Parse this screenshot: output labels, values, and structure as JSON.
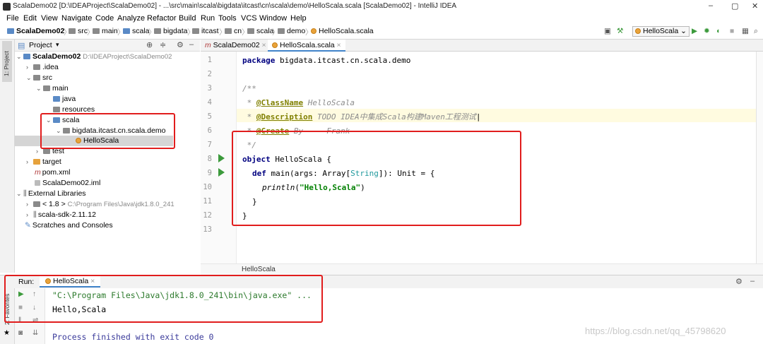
{
  "window": {
    "title": "ScalaDemo02 [D:\\IDEAProject\\ScalaDemo02] - ...\\src\\main\\scala\\bigdata\\itcast\\cn\\scala\\demo\\HelloScala.scala [ScalaDemo02] - IntelliJ IDEA",
    "minimize": "–",
    "restore": "▢",
    "close": "✕"
  },
  "menu": [
    "File",
    "Edit",
    "View",
    "Navigate",
    "Code",
    "Analyze",
    "Refactor",
    "Build",
    "Run",
    "Tools",
    "VCS",
    "Window",
    "Help"
  ],
  "breadcrumbs": [
    "ScalaDemo02",
    "src",
    "main",
    "scala",
    "bigdata",
    "itcast",
    "cn",
    "scala",
    "demo",
    "HelloScala.scala"
  ],
  "toolbar": {
    "run_config": "HelloScala"
  },
  "project": {
    "panel_title": "Project",
    "side_tab": "1: Project",
    "favorites_tab": "2: Favorites",
    "tree": {
      "root": "ScalaDemo02",
      "root_path": "D:\\IDEAProject\\ScalaDemo02",
      "idea": ".idea",
      "src": "src",
      "main": "main",
      "java": "java",
      "resources": "resources",
      "scala": "scala",
      "package": "bigdata.itcast.cn.scala.demo",
      "class": "HelloScala",
      "test": "test",
      "target": "target",
      "pom": "pom.xml",
      "iml": "ScalaDemo02.iml",
      "ext_libs": "External Libraries",
      "jdk": "< 1.8 >",
      "jdk_path": "C:\\Program Files\\Java\\jdk1.8.0_241",
      "scala_sdk": "scala-sdk-2.11.12",
      "scratches": "Scratches and Consoles"
    }
  },
  "editor": {
    "tabs": [
      "ScalaDemo02",
      "HelloScala.scala"
    ],
    "line_numbers": [
      "1",
      "2",
      "3",
      "4",
      "5",
      "6",
      "7",
      "8",
      "9",
      "10",
      "11",
      "12",
      "13"
    ],
    "code": {
      "l1_kw": "package",
      "l1_rest": " bigdata.itcast.cn.scala.demo",
      "l3": "/**",
      "l4_star": " * ",
      "l4_tag": "@ClassName",
      "l4_rest": " HelloScala",
      "l5_star": " * ",
      "l5_tag": "@Description",
      "l5_rest": " TODO IDEA中集成Scala构建Maven工程测试",
      "l6_star": " * ",
      "l6_tag": "@Create",
      "l6_rest": " By     Frank",
      "l7": " */",
      "l8_kw": "object",
      "l8_rest": " HelloScala {",
      "l9_kw": "def",
      "l9_a": " main(args: Array[",
      "l9_type": "String",
      "l9_b": "]): Unit = {",
      "l10_fn": "println",
      "l10_a": "(",
      "l10_str": "\"Hello,Scala\"",
      "l10_b": ")",
      "l11": "}",
      "l12": "}"
    },
    "breadcrumb": "HelloScala"
  },
  "run": {
    "label": "Run:",
    "tab": "HelloScala",
    "output": [
      "\"C:\\Program Files\\Java\\jdk1.8.0_241\\bin\\java.exe\" ...",
      "Hello,Scala",
      "Process finished with exit code 0"
    ]
  },
  "watermark": "https://blog.csdn.net/qq_45798620",
  "colors": {
    "highlight_box": "#e11d1d",
    "run_green": "#3c9a3c",
    "selection": "#d5d5d5"
  }
}
